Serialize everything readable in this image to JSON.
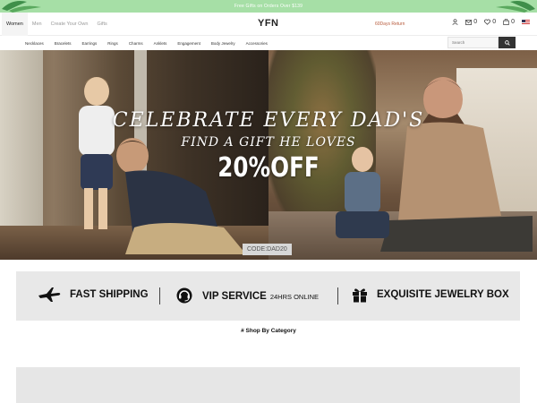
{
  "promo": {
    "text": "Free Gifts on Orders Over $139"
  },
  "header": {
    "tabs": [
      {
        "label": "Women",
        "active": true
      },
      {
        "label": "Men",
        "active": false
      },
      {
        "label": "Create Your Own",
        "active": false
      },
      {
        "label": "Gifts",
        "active": false
      }
    ],
    "logo": "YFN",
    "returns": "60Days Return",
    "mail_count": "0",
    "wishlist_count": "0",
    "cart_count": "0"
  },
  "categories": [
    "Necklaces",
    "Bracelets",
    "Earrings",
    "Rings",
    "Charms",
    "Anklets",
    "Engagement",
    "Body Jewelry",
    "Accessories"
  ],
  "search": {
    "placeholder": "Search"
  },
  "hero": {
    "title": "CELEBRATE EVERY DAD'S",
    "subtitle": "FIND A GIFT HE LOVES",
    "offer": "20%OFF",
    "code": "CODE:DAD20"
  },
  "features": {
    "shipping": "FAST SHIPPING",
    "vip": "VIP SERVICE",
    "vip_note": "24HRS ONLINE",
    "jewelry_box": "EXQUISITE JEWELRY BOX"
  },
  "section": {
    "title": "# Shop By Category"
  },
  "colors": {
    "promo": "#a6dfa6",
    "returns": "#b75a3b",
    "feature_bg": "#e8e8e8"
  }
}
